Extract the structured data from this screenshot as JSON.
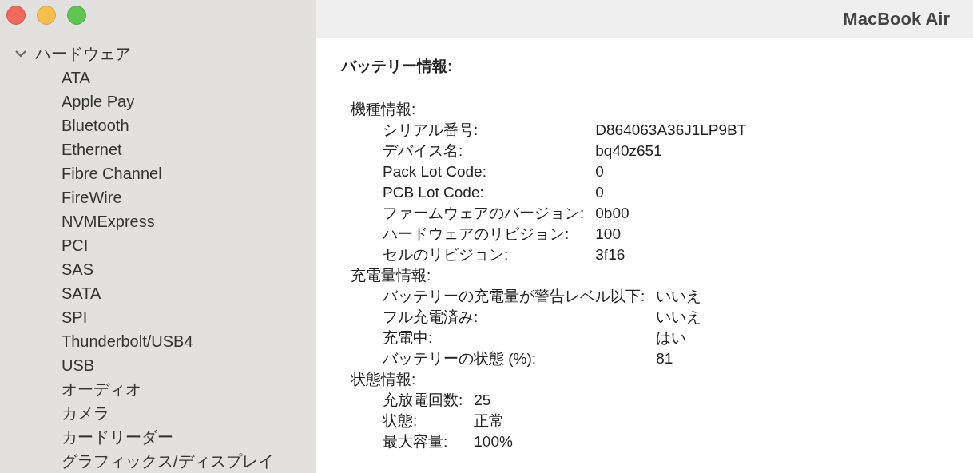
{
  "window": {
    "title": "MacBook Air"
  },
  "sidebar": {
    "section": {
      "label": "ハードウェア",
      "expanded": true
    },
    "items": [
      "ATA",
      "Apple Pay",
      "Bluetooth",
      "Ethernet",
      "Fibre Channel",
      "FireWire",
      "NVMExpress",
      "PCI",
      "SAS",
      "SATA",
      "SPI",
      "Thunderbolt/USB4",
      "USB",
      "オーディオ",
      "カメラ",
      "カードリーダー",
      "グラフィックス/ディスプレイ"
    ]
  },
  "content": {
    "heading": "バッテリー情報:",
    "groups": [
      {
        "title": "機種情報:",
        "rows": [
          {
            "label": "シリアル番号:",
            "value": "D864063A36J1LP9BT"
          },
          {
            "label": "デバイス名:",
            "value": "bq40z651"
          },
          {
            "label": "Pack Lot Code:",
            "value": "0"
          },
          {
            "label": "PCB Lot Code:",
            "value": "0"
          },
          {
            "label": "ファームウェアのバージョン:",
            "value": "0b00"
          },
          {
            "label": "ハードウェアのリビジョン:",
            "value": "100"
          },
          {
            "label": "セルのリビジョン:",
            "value": "3f16"
          }
        ]
      },
      {
        "title": "充電量情報:",
        "rows": [
          {
            "label": "バッテリーの充電量が警告レベル以下:",
            "value": "いいえ"
          },
          {
            "label": "フル充電済み:",
            "value": "いいえ"
          },
          {
            "label": "充電中:",
            "value": "はい"
          },
          {
            "label": "バッテリーの状態 (%):",
            "value": "81"
          }
        ]
      },
      {
        "title": "状態情報:",
        "rows": [
          {
            "label": "充放電回数:",
            "value": "25"
          },
          {
            "label": "状態:",
            "value": "正常"
          },
          {
            "label": "最大容量:",
            "value": "100%"
          }
        ]
      }
    ]
  }
}
